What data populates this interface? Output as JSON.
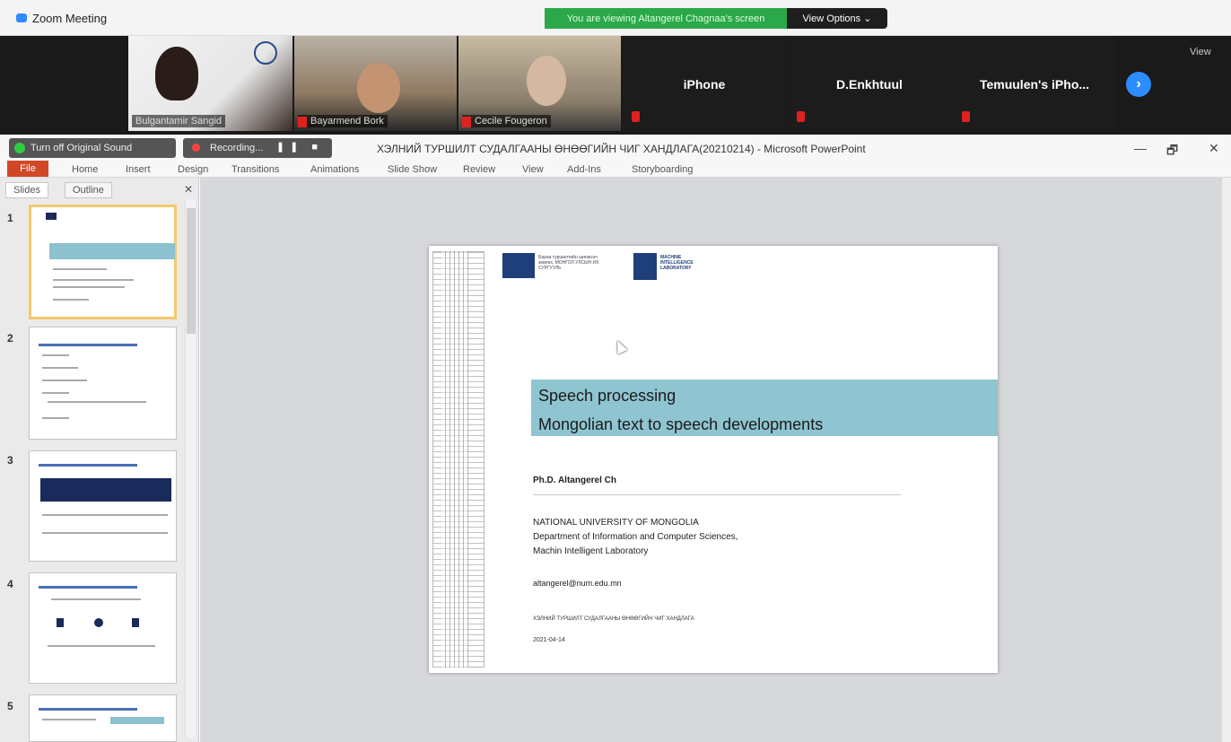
{
  "zoom": {
    "window_title": "Zoom Meeting",
    "viewing_banner": "You are viewing Altangerel Chagnaa's screen",
    "view_options": "View Options ⌄",
    "view_label": "View"
  },
  "participants": [
    {
      "name": "Bulgantamir Sangid"
    },
    {
      "name": "Bayarmend Bork"
    },
    {
      "name": "Cecile Fougeron"
    },
    {
      "name": "iPhone"
    },
    {
      "name": "D.Enkhtuul"
    },
    {
      "name": "Temuulen's iPho..."
    }
  ],
  "share_toolbar": {
    "original_sound": "Turn off Original Sound",
    "recording": "Recording...",
    "recording_controls": "❚❚ ■"
  },
  "powerpoint": {
    "title": "ХЭЛНИЙ ТУРШИЛТ СУДАЛГААНЫ ӨНӨӨГИЙН ЧИГ ХАНДЛАГА(20210214)  -  Microsoft PowerPoint",
    "window_controls": [
      "—",
      "🗗",
      "✕"
    ],
    "ribbon_tabs": [
      "File",
      "Home",
      "Insert",
      "Design",
      "Transitions",
      "Animations",
      "Slide Show",
      "Review",
      "View",
      "Add-Ins",
      "Storyboarding"
    ],
    "pane_tabs": [
      "Slides",
      "Outline"
    ],
    "pane_close": "✕",
    "slide_numbers": [
      "1",
      "2",
      "3",
      "4",
      "5"
    ]
  },
  "slide": {
    "logo_org_text": "Бараа туршилтийн шинжээч зөвлөх, МОНГОЛ УЛСЫН ИХ СУРГУУЛЬ",
    "logo_lab_text": "MACHINE INTELLIGENCE LABORATORY",
    "title_line1": "Speech processing",
    "title_line2": "Mongolian text to speech developments",
    "author": "Ph.D. Altangerel Ch",
    "affiliation_line1": "NATIONAL UNIVERSITY OF MONGOLIA",
    "affiliation_line2": "Department of Information and Computer Sciences,",
    "affiliation_line3": "Machin Intelligent Laboratory",
    "email": "altangerel@num.edu.mn",
    "footer_title": "ХЭЛНИЙ ТУРШИЛТ СУДАЛГААНЫ ӨНӨӨГИЙН ЧИГ ХАНДЛАГА",
    "date": "2021-04-14"
  }
}
